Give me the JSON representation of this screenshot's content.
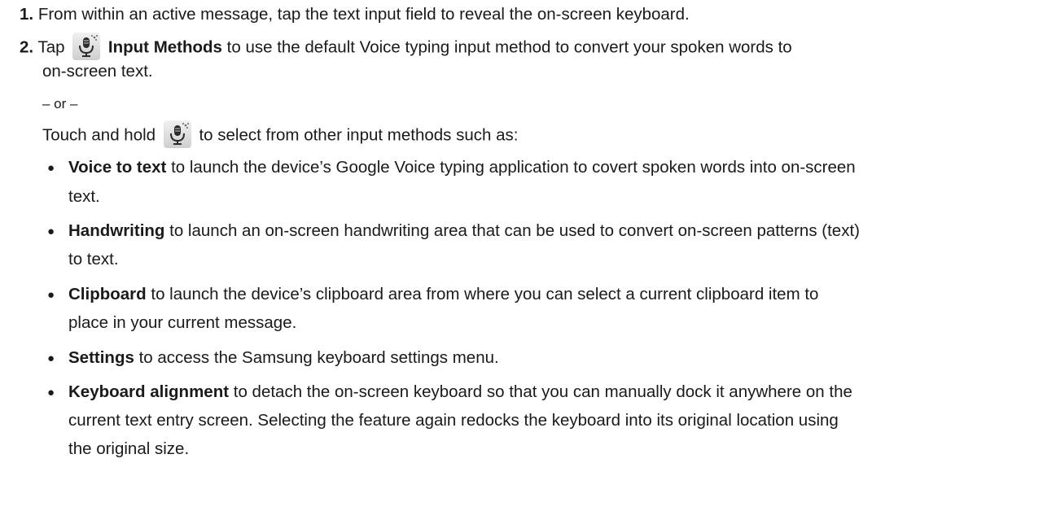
{
  "step1": {
    "number": "1.",
    "text": "From within an active message, tap the text input field to reveal the on-screen keyboard."
  },
  "step2": {
    "number": "2.",
    "tap": "Tap",
    "input_methods": "Input Methods",
    "rest_line1": "to use the default Voice typing input method to convert your spoken words to",
    "rest_line2": "on-screen text.",
    "or": "– or –",
    "touch_hold": "Touch and hold",
    "touch_hold_rest": "to select from other input methods such as:",
    "mic_icon": "microphone-settings-icon"
  },
  "bullets": [
    {
      "term": "Voice to text",
      "line1": "to launch the device’s Google Voice typing application to covert spoken words into on-screen",
      "line2": "text."
    },
    {
      "term": "Handwriting",
      "line1": "to launch an on-screen handwriting area that can be used to convert on-screen patterns (text)",
      "line2": "to text."
    },
    {
      "term": "Clipboard",
      "line1": "to launch the device’s clipboard area from where you can select a current clipboard item to",
      "line2": "place in your current message."
    },
    {
      "term": "Settings",
      "line1": "to access the Samsung keyboard settings menu."
    },
    {
      "term": "Keyboard alignment",
      "line1": "to detach the on-screen keyboard so that you can manually dock it anywhere on the",
      "line2": "current text entry screen. Selecting the feature again redocks the keyboard into its original location using",
      "line3": "the original size."
    }
  ],
  "bullet_glyph": "●"
}
